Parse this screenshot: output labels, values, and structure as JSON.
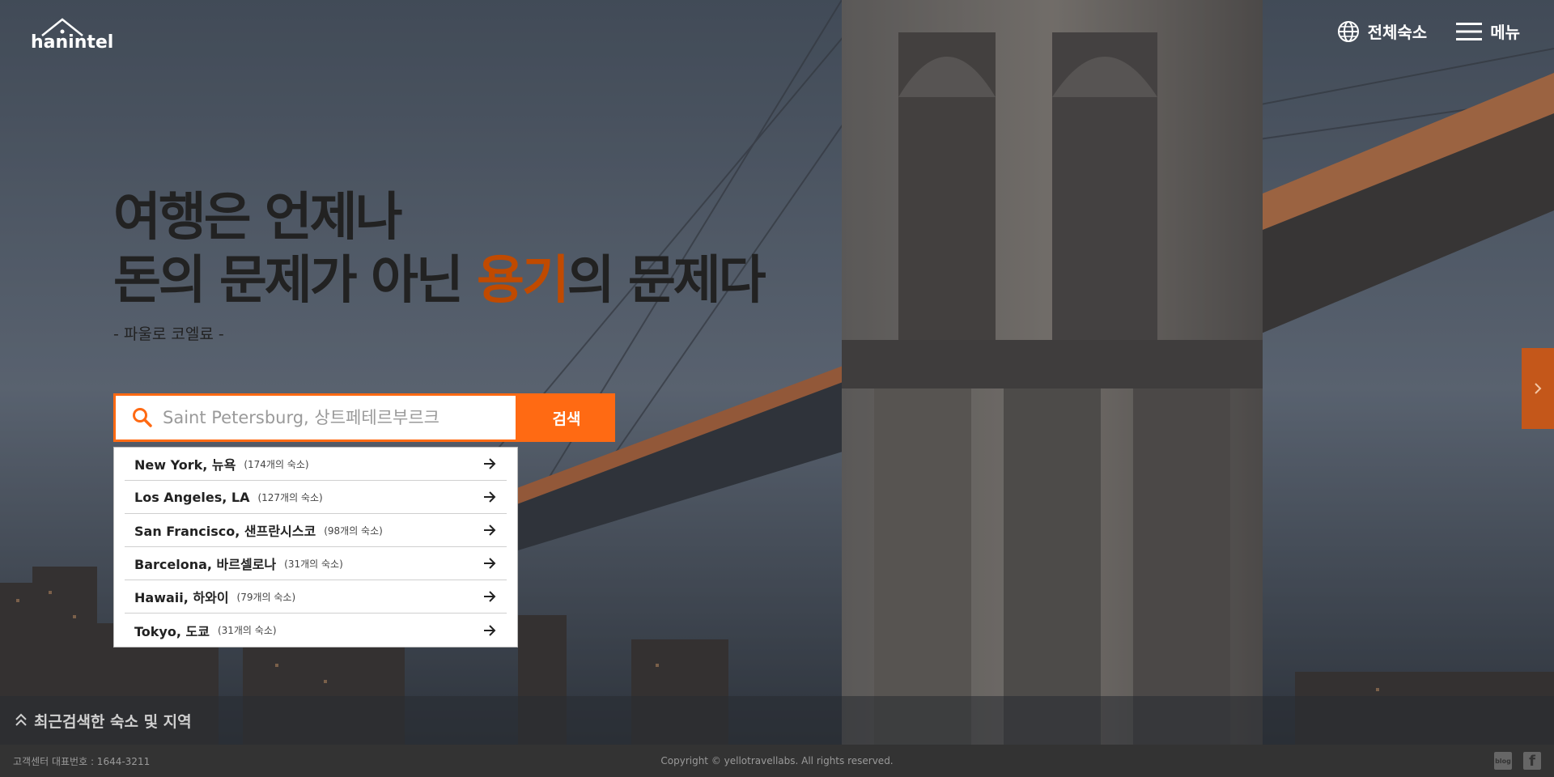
{
  "brand": {
    "logo_text": "hanintel"
  },
  "header": {
    "all_stays_label": "전체숙소",
    "menu_label": "메뉴"
  },
  "hero": {
    "line1": "여행은 언제나",
    "line2_before": "돈의 문제가 아닌 ",
    "line2_accent": "용기",
    "line2_after": "의 문제다",
    "quote": "- 파울로 코엘료 -"
  },
  "search": {
    "placeholder": "Saint Petersburg, 상트페테르부르크",
    "button_label": "검색",
    "suggestions": [
      {
        "name": "New York, 뉴욕",
        "count": "(174개의 숙소)"
      },
      {
        "name": "Los Angeles, LA",
        "count": "(127개의 숙소)"
      },
      {
        "name": "San Francisco, 샌프란시스코",
        "count": "(98개의 숙소)"
      },
      {
        "name": "Barcelona, 바르셀로나",
        "count": "(31개의 숙소)"
      },
      {
        "name": "Hawaii, 하와이",
        "count": "(79개의 숙소)"
      },
      {
        "name": "Tokyo, 도쿄",
        "count": "(31개의 숙소)"
      }
    ]
  },
  "recent": {
    "label": "최근검색한 숙소 및 지역"
  },
  "footer": {
    "customer_center": "고객센터 대표번호 : 1644-3211",
    "copyright": "Copyright © yellotravellabs. All rights reserved.",
    "blog_label": "blog"
  },
  "colors": {
    "accent": "#ff6a13",
    "accent_dark": "#c04a00",
    "footer_bg": "#333333"
  },
  "icons": [
    "logo-house-icon",
    "globe-icon",
    "hamburger-icon",
    "search-icon",
    "arrow-right-icon",
    "chevron-right-icon",
    "double-chevron-up-icon",
    "blog-icon",
    "facebook-icon"
  ]
}
